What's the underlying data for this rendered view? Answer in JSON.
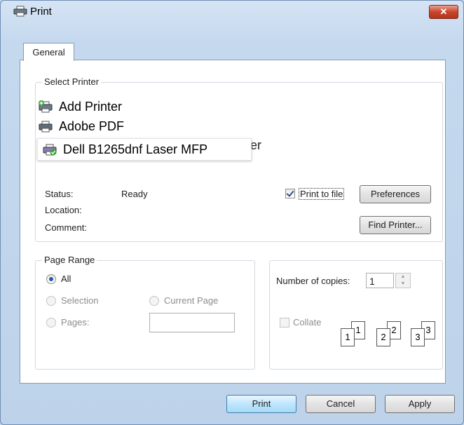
{
  "window": {
    "title": "Print",
    "close_label": "✕"
  },
  "tabs": [
    {
      "label": "General"
    }
  ],
  "select_printer": {
    "group_label": "Select Printer",
    "printers": [
      {
        "label": "Add Printer",
        "icon": "add-printer-icon"
      },
      {
        "label": "Adobe PDF",
        "icon": "printer-icon"
      },
      {
        "label": "Dell B1265dnf Laser MFP",
        "icon": "default-printer-icon",
        "selected": true
      }
    ],
    "hidden_suffix": "er"
  },
  "status": {
    "status_label": "Status:",
    "status_value": "Ready",
    "location_label": "Location:",
    "comment_label": "Comment:"
  },
  "print_to_file": {
    "label": "Print to file",
    "checked": true
  },
  "buttons": {
    "preferences": "Preferences",
    "find_printer": "Find Printer...",
    "print": "Print",
    "cancel": "Cancel",
    "apply": "Apply"
  },
  "page_range": {
    "group_label": "Page Range",
    "all": "All",
    "selection": "Selection",
    "current_page": "Current Page",
    "pages": "Pages:",
    "pages_value": ""
  },
  "copies": {
    "label": "Number of copies:",
    "value": "1",
    "collate_label": "Collate",
    "collate_checked": false,
    "sheets": [
      "1",
      "1",
      "2",
      "2",
      "3",
      "3"
    ]
  }
}
